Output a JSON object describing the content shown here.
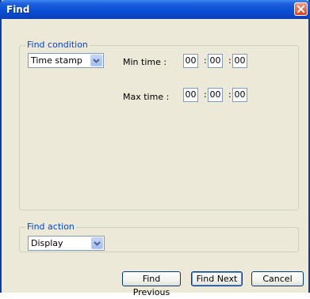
{
  "window": {
    "title": "Find"
  },
  "find_condition": {
    "label": "Find condition",
    "field_select": "Time stamp",
    "min_time_label": "Min time :",
    "max_time_label": "Max time :",
    "min_time": {
      "hh": "00",
      "mm": "00",
      "ss": "00"
    },
    "max_time": {
      "hh": "00",
      "mm": "00",
      "ss": "00"
    },
    "separator": ":"
  },
  "find_action": {
    "label": "Find action",
    "action_select": "Display"
  },
  "buttons": {
    "find_previous": "Find Previous",
    "find_next": "Find Next",
    "cancel": "Cancel"
  },
  "colors": {
    "title_bar": "#0a4fd6",
    "group_label": "#0046d5",
    "close_button": "#d9431e"
  }
}
